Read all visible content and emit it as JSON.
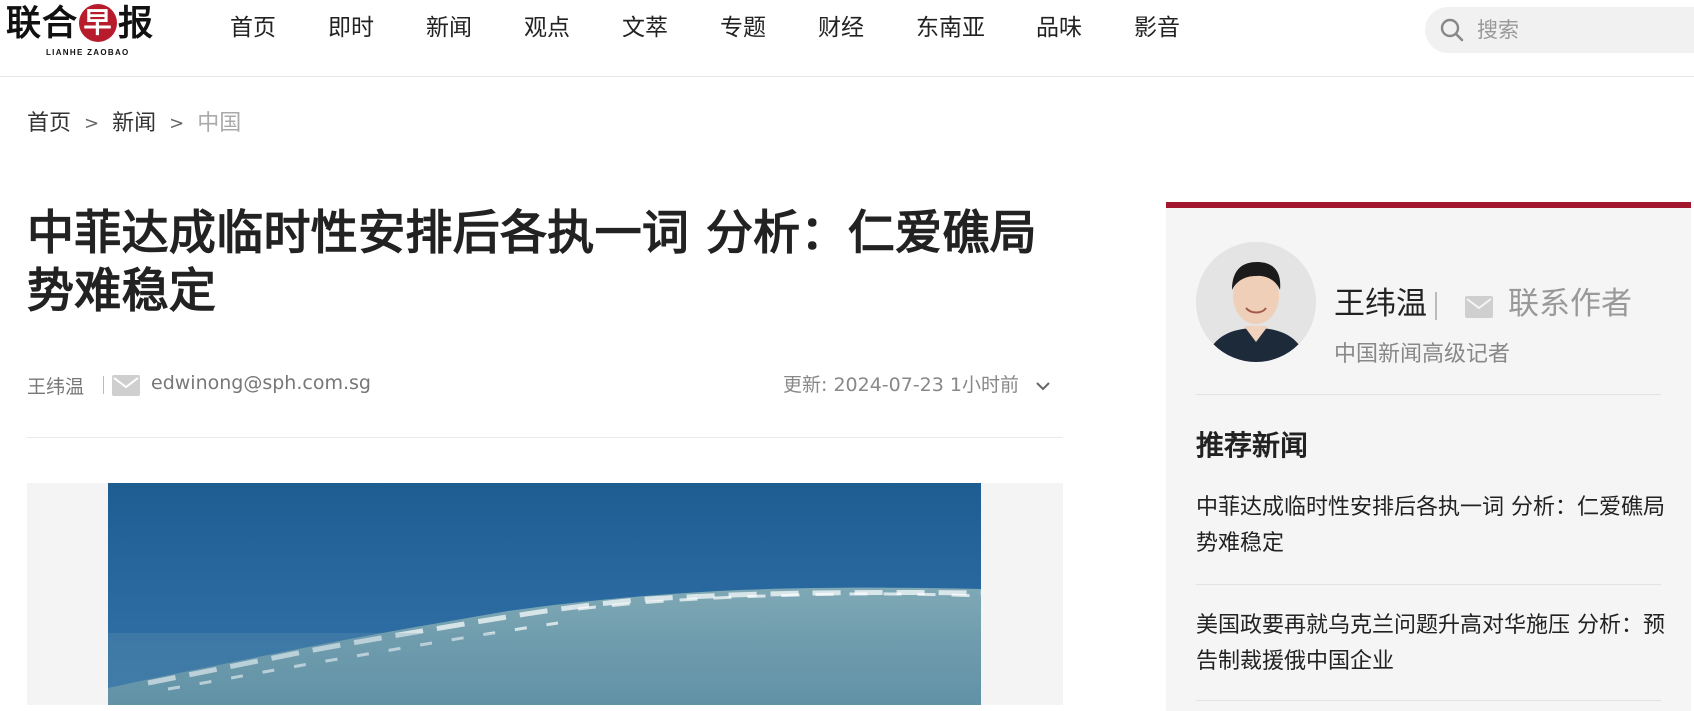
{
  "brand": {
    "logo_text_left": "联合",
    "logo_badge": "早",
    "logo_text_right": "报",
    "logo_sub": "LIANHE ZAOBAO"
  },
  "nav": {
    "items": [
      "首页",
      "即时",
      "新闻",
      "观点",
      "文萃",
      "专题",
      "财经",
      "东南亚",
      "品味",
      "影音"
    ]
  },
  "search": {
    "placeholder": "搜索",
    "icon": "search-icon"
  },
  "breadcrumb": {
    "home": "首页",
    "section": "新闻",
    "current": "中国",
    "separator": ">"
  },
  "article": {
    "title": "中菲达成临时性安排后各执一词 分析：仁爱礁局势难稳定",
    "author": "王纬温",
    "email": "edwinong@sph.com.sg",
    "updated": "更新: 2024-07-23 1小时前"
  },
  "sidebar": {
    "author_name": "王纬温",
    "contact_label": "联系作者",
    "author_role": "中国新闻高级记者",
    "recommended_heading": "推荐新闻",
    "recommended": [
      "中菲达成临时性安排后各执一词 分析：仁爱礁局势难稳定",
      "美国政要再就乌克兰问题升高对华施压 分析：预告制裁援俄中国企业"
    ]
  },
  "colors": {
    "accent": "#a3172e",
    "logo_badge": "#b71c2c",
    "sidebar_bg": "#f5f5f5",
    "image_frame_bg": "#f4f4f4",
    "muted_text": "#888888"
  }
}
